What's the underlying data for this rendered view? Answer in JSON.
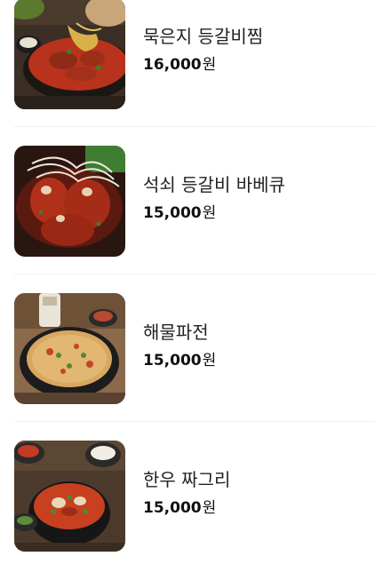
{
  "menu": {
    "items": [
      {
        "name": "묵은지 등갈비찜",
        "price": "16,000",
        "currency": "원",
        "image": "braised-ribs-kimchi-photo"
      },
      {
        "name": "석쇠 등갈비 바베큐",
        "price": "15,000",
        "currency": "원",
        "image": "grilled-ribs-bbq-photo"
      },
      {
        "name": "해물파전",
        "price": "15,000",
        "currency": "원",
        "image": "seafood-pancake-photo"
      },
      {
        "name": "한우 짜그리",
        "price": "15,000",
        "currency": "원",
        "image": "hanwoo-stew-photo"
      }
    ]
  }
}
